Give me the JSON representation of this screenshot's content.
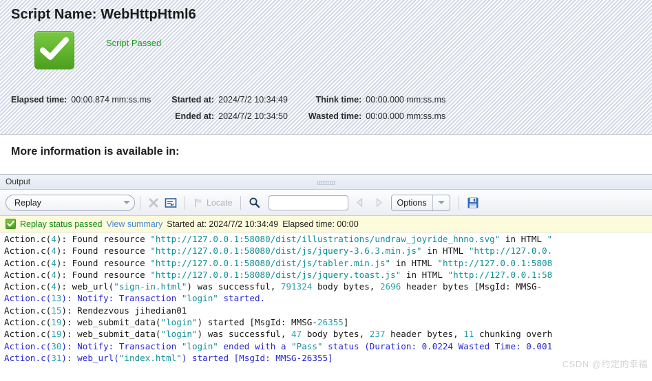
{
  "summary": {
    "script_title": "Script Name: WebHttpHtml6",
    "status_text": "Script Passed",
    "status_icon": "check-icon",
    "status_color": "#18a018",
    "metrics": [
      {
        "label": "Elapsed time:",
        "value": "00:00.874 mm:ss.ms"
      },
      {
        "label": "Started at:",
        "value": "2024/7/2 10:34:49"
      },
      {
        "label": "Think time:",
        "value": "00:00.000 mm:ss.ms"
      },
      {
        "label": "Ended at:",
        "value": "2024/7/2 10:34:50"
      },
      {
        "label": "Wasted time:",
        "value": "00:00.000 mm:ss.ms"
      }
    ]
  },
  "more_info": {
    "heading": "More information is available in:"
  },
  "output_pane": {
    "title": "Output",
    "toolbar": {
      "source_select": "Replay",
      "clear_icon": "clear-x-icon",
      "wrap_icon": "word-wrap-icon",
      "locate_label": "Locate",
      "locate_icon": "locate-flag-icon",
      "search_icon": "search-icon",
      "search_value": "",
      "search_placeholder": "",
      "prev_icon": "prev-arrow-icon",
      "next_icon": "next-arrow-icon",
      "options_label": "Options",
      "options_caret_icon": "chevron-down-icon",
      "save_icon": "save-disk-icon"
    },
    "status_strip": {
      "icon": "check-icon",
      "status": "Replay status passed",
      "link": "View summary",
      "started": "Started at: 2024/7/2 10:34:49",
      "elapsed": "Elapsed time: 00:00"
    }
  },
  "log": {
    "lines": [
      [
        {
          "t": "Action.c(",
          "c": "black"
        },
        {
          "t": "4",
          "c": "num"
        },
        {
          "t": "): Found resource ",
          "c": "black"
        },
        {
          "t": "\"http://127.0.0.1:58080/dist/illustrations/undraw_joyride_hnno.svg\"",
          "c": "teal"
        },
        {
          "t": " in HTML ",
          "c": "black"
        },
        {
          "t": "\"",
          "c": "teal"
        }
      ],
      [
        {
          "t": "Action.c(",
          "c": "black"
        },
        {
          "t": "4",
          "c": "num"
        },
        {
          "t": "): Found resource ",
          "c": "black"
        },
        {
          "t": "\"http://127.0.0.1:58080/dist/js/jquery-3.6.3.min.js\"",
          "c": "teal"
        },
        {
          "t": " in HTML ",
          "c": "black"
        },
        {
          "t": "\"http://127.0.0.",
          "c": "teal"
        }
      ],
      [
        {
          "t": "Action.c(",
          "c": "black"
        },
        {
          "t": "4",
          "c": "num"
        },
        {
          "t": "): Found resource ",
          "c": "black"
        },
        {
          "t": "\"http://127.0.0.1:58080/dist/js/tabler.min.js\"",
          "c": "teal"
        },
        {
          "t": " in HTML ",
          "c": "black"
        },
        {
          "t": "\"http://127.0.0.1:5808",
          "c": "teal"
        }
      ],
      [
        {
          "t": "Action.c(",
          "c": "black"
        },
        {
          "t": "4",
          "c": "num"
        },
        {
          "t": "): Found resource ",
          "c": "black"
        },
        {
          "t": "\"http://127.0.0.1:58080/dist/js/jquery.toast.js\"",
          "c": "teal"
        },
        {
          "t": " in HTML ",
          "c": "black"
        },
        {
          "t": "\"http://127.0.0.1:58",
          "c": "teal"
        }
      ],
      [
        {
          "t": "Action.c(",
          "c": "black"
        },
        {
          "t": "4",
          "c": "num"
        },
        {
          "t": "): web_url(",
          "c": "black"
        },
        {
          "t": "\"sign-in.html\"",
          "c": "teal"
        },
        {
          "t": ") was successful, ",
          "c": "black"
        },
        {
          "t": "791324",
          "c": "num"
        },
        {
          "t": " body bytes, ",
          "c": "black"
        },
        {
          "t": "2696",
          "c": "num"
        },
        {
          "t": " header bytes   [MsgId: MMSG-",
          "c": "black"
        }
      ],
      [
        {
          "t": "Action.c(",
          "c": "blue"
        },
        {
          "t": "13",
          "c": "num"
        },
        {
          "t": "): Notify: Transaction ",
          "c": "blue"
        },
        {
          "t": "\"login\"",
          "c": "teal"
        },
        {
          "t": " started.",
          "c": "blue"
        }
      ],
      [
        {
          "t": "Action.c(",
          "c": "black"
        },
        {
          "t": "15",
          "c": "num"
        },
        {
          "t": "): Rendezvous jihedian01",
          "c": "black"
        }
      ],
      [
        {
          "t": "Action.c(",
          "c": "black"
        },
        {
          "t": "19",
          "c": "num"
        },
        {
          "t": "): web_submit_data(",
          "c": "black"
        },
        {
          "t": "\"login\"",
          "c": "teal"
        },
        {
          "t": ") started     [MsgId: MMSG-",
          "c": "black"
        },
        {
          "t": "26355",
          "c": "num"
        },
        {
          "t": "]",
          "c": "black"
        }
      ],
      [
        {
          "t": "Action.c(",
          "c": "black"
        },
        {
          "t": "19",
          "c": "num"
        },
        {
          "t": "): web_submit_data(",
          "c": "black"
        },
        {
          "t": "\"login\"",
          "c": "teal"
        },
        {
          "t": ") was successful, ",
          "c": "black"
        },
        {
          "t": "47",
          "c": "num"
        },
        {
          "t": " body bytes, ",
          "c": "black"
        },
        {
          "t": "237",
          "c": "num"
        },
        {
          "t": " header bytes, ",
          "c": "black"
        },
        {
          "t": "11",
          "c": "num"
        },
        {
          "t": " chunking overh",
          "c": "black"
        }
      ],
      [
        {
          "t": "Action.c(",
          "c": "blue"
        },
        {
          "t": "30",
          "c": "num"
        },
        {
          "t": "): Notify: Transaction ",
          "c": "blue"
        },
        {
          "t": "\"login\"",
          "c": "teal"
        },
        {
          "t": " ended with a ",
          "c": "blue"
        },
        {
          "t": "\"Pass\"",
          "c": "teal"
        },
        {
          "t": " status (Duration: 0.0224 Wasted Time: 0.001",
          "c": "blue"
        }
      ],
      [
        {
          "t": "Action.c(",
          "c": "blue"
        },
        {
          "t": "31",
          "c": "num"
        },
        {
          "t": "): web_url(",
          "c": "blue"
        },
        {
          "t": "\"index.html\"",
          "c": "teal"
        },
        {
          "t": ") started     [MsgId: MMSG-26355]",
          "c": "blue"
        }
      ]
    ],
    "watermark": "CSDN @约定的幸福"
  }
}
